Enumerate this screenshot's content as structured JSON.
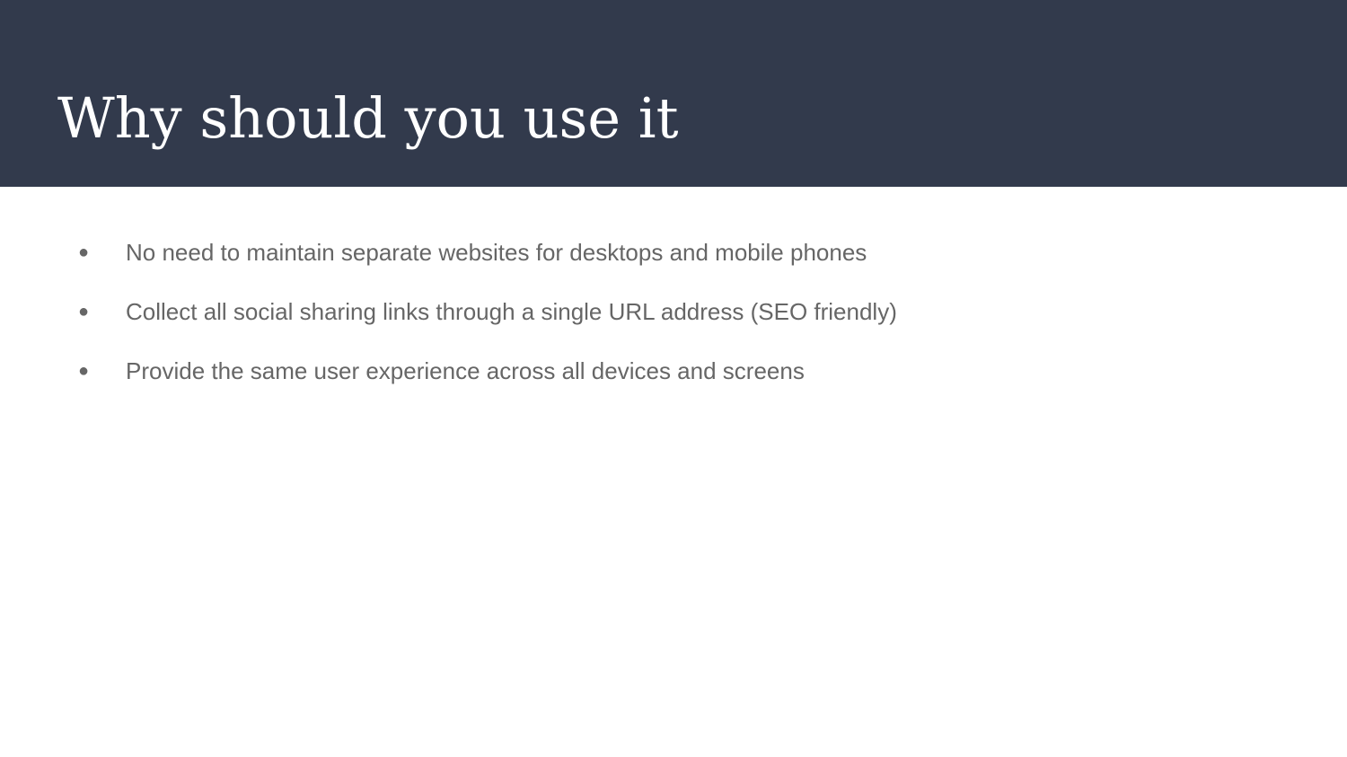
{
  "slide": {
    "title": "Why should you use it",
    "bullets": [
      {
        "marker": "●",
        "text": "No need to maintain separate websites for desktops and mobile phones"
      },
      {
        "marker": "●",
        "text": "Collect all social sharing links through a single URL address (SEO friendly)"
      },
      {
        "marker": "●",
        "text": "Provide the same user experience across all devices and screens"
      }
    ]
  },
  "colors": {
    "title_band": "#323a4c",
    "title_text": "#ffffff",
    "body_text": "#666666",
    "background": "#ffffff"
  }
}
